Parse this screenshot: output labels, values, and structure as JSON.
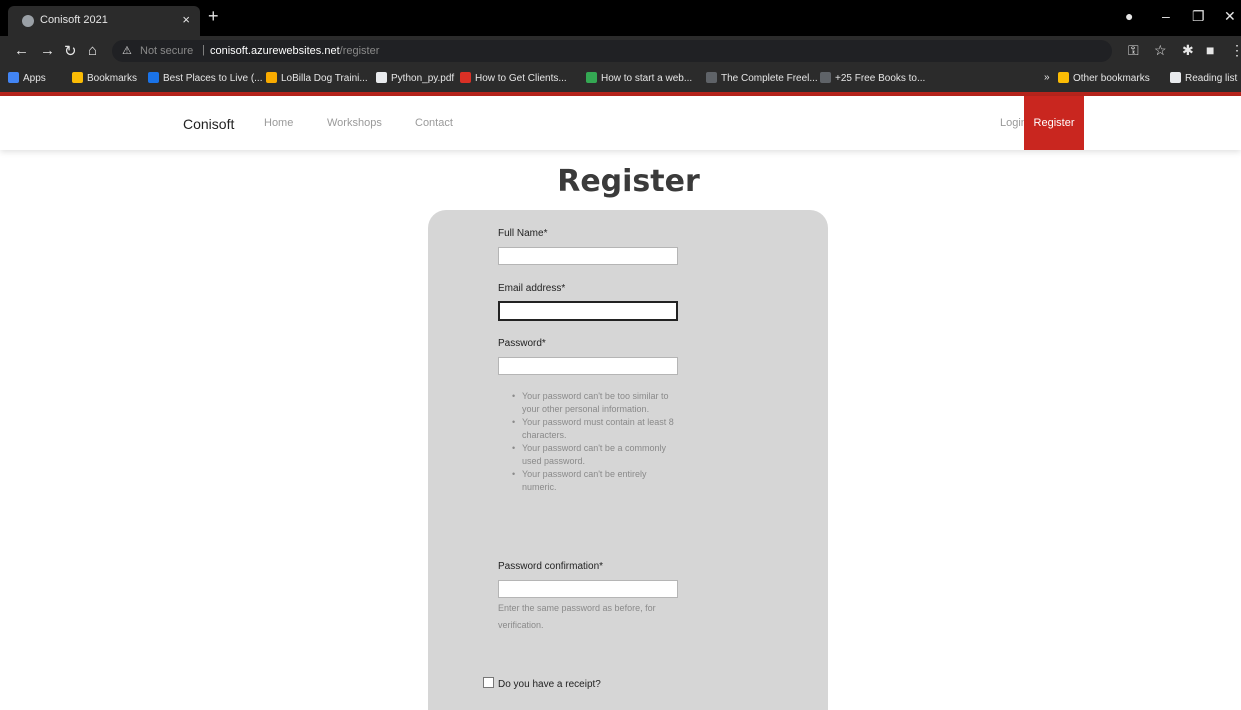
{
  "browser": {
    "tab_title": "Conisoft 2021",
    "tab_close": "×",
    "new_tab": "+",
    "security_label": "Not secure",
    "url_host": "conisoft.azurewebsites.net",
    "url_path": "/register",
    "bookmarks": [
      {
        "label": "Apps",
        "color": "#4285f4"
      },
      {
        "label": "Bookmarks",
        "color": "#fbbc05"
      },
      {
        "label": "Best Places to Live (...",
        "color": "#1a73e8"
      },
      {
        "label": "LoBilla Dog Traini...",
        "color": "#f9ab00"
      },
      {
        "label": "Python_py.pdf",
        "color": "#e8eaed"
      },
      {
        "label": "How to Get Clients...",
        "color": "#d93025"
      },
      {
        "label": "How to start a web...",
        "color": "#34a853"
      },
      {
        "label": "The Complete Freel...",
        "color": "#5f6368"
      },
      {
        "label": "+25 Free Books to...",
        "color": "#5f6368"
      }
    ],
    "bookmarks_more": "»",
    "other_bookmarks": "Other bookmarks",
    "reading_list": "Reading list"
  },
  "site": {
    "brand": "Conisoft",
    "nav": {
      "home": "Home",
      "workshops": "Workshops",
      "contact": "Contact",
      "login": "Login",
      "register": "Register"
    },
    "accent_color": "#c9261f"
  },
  "form": {
    "title": "Register",
    "full_name_label": "Full Name*",
    "email_label": "Email address*",
    "password_label": "Password*",
    "password_help": [
      "Your password can't be too similar to your other personal information.",
      "Your password must contain at least 8 characters.",
      "Your password can't be a commonly used password.",
      "Your password can't be entirely numeric."
    ],
    "password_confirm_label": "Password confirmation*",
    "password_confirm_help": "Enter the same password as before, for verification.",
    "receipt_label": "Do you have a receipt?"
  }
}
